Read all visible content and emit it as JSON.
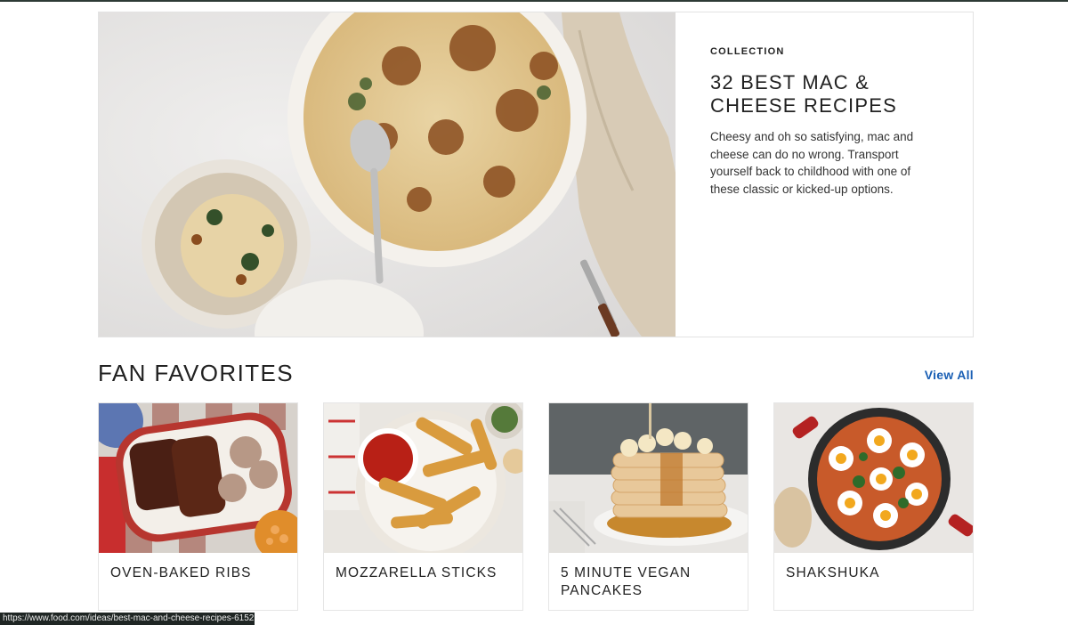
{
  "hero": {
    "eyebrow": "COLLECTION",
    "title": "32 BEST MAC & CHEESE RECIPES",
    "description": "Cheesy and oh so satisfying, mac and cheese can do no wrong. Transport yourself back to childhood with one of these classic or kicked-up options."
  },
  "section": {
    "title": "FAN FAVORITES",
    "view_all": "View All"
  },
  "cards": [
    {
      "title": "OVEN-BAKED RIBS"
    },
    {
      "title": "MOZZARELLA STICKS"
    },
    {
      "title": "5 MINUTE VEGAN PANCAKES"
    },
    {
      "title": "SHAKSHUKA"
    }
  ],
  "status_bar": {
    "url": "https://www.food.com/ideas/best-mac-and-cheese-recipes-6152"
  },
  "colors": {
    "link": "#1a5fb4",
    "top_rule": "#2d3a35",
    "status_bar": "#1f2624"
  }
}
